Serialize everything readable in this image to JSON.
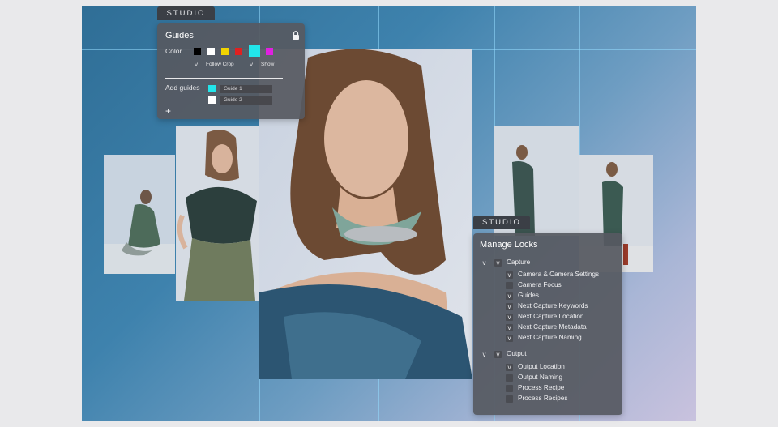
{
  "studio_tag": "STUDIO",
  "guides_panel": {
    "title": "Guides",
    "color_label": "Color",
    "colors": [
      "#000000",
      "#ffffff",
      "#f2d400",
      "#e02020",
      "#22e5ea",
      "#e020e0"
    ],
    "follow_crop_label": "Follow Crop",
    "show_label": "Show",
    "add_guides_label": "Add guides",
    "guides": [
      {
        "name": "Guide 1",
        "color": "#22e5ea"
      },
      {
        "name": "Guide 2",
        "color": "#ffffff"
      }
    ],
    "add_symbol": "+",
    "lock_icon": "lock-icon"
  },
  "locks_panel": {
    "title": "Manage Locks",
    "groups": [
      {
        "label": "Capture",
        "items": [
          {
            "label": "Camera & Camera Settings",
            "checked": true
          },
          {
            "label": "Camera Focus",
            "checked": false
          },
          {
            "label": "Guides",
            "checked": true
          },
          {
            "label": "Next Capture Keywords",
            "checked": true
          },
          {
            "label": "Next Capture Location",
            "checked": true
          },
          {
            "label": "Next Capture Metadata",
            "checked": true
          },
          {
            "label": "Next Capture Naming",
            "checked": true
          }
        ]
      },
      {
        "label": "Output",
        "items": [
          {
            "label": "Output Location",
            "checked": true
          },
          {
            "label": "Output Naming",
            "checked": false
          },
          {
            "label": "Process Recipe",
            "checked": false
          },
          {
            "label": "Process Recipes",
            "checked": false
          }
        ]
      }
    ]
  }
}
